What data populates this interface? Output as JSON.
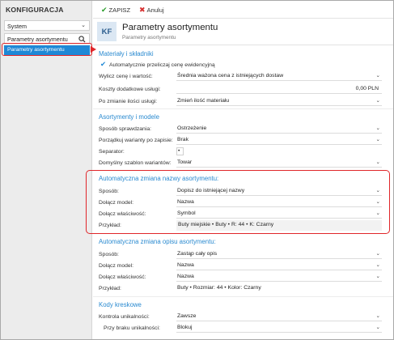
{
  "sidebar": {
    "title": "KONFIGURACJA",
    "select_value": "System",
    "search_value": "Parametry asortymentu",
    "active_item": "Parametry asortymentu"
  },
  "toolbar": {
    "save_label": "ZAPISZ",
    "cancel_label": "Anuluj"
  },
  "header": {
    "badge": "KF",
    "title": "Parametry asortymentu",
    "subtitle": "Parametry asortymentu"
  },
  "sections": {
    "materials": {
      "title": "Materiały i składniki",
      "checkbox_label": "Automatycznie przeliczaj cenę ewidencyjną",
      "rows": [
        {
          "label": "Wylicz cenę i wartość:",
          "value": "Średnia ważona cena z istniejących dostaw"
        },
        {
          "label": "Koszty dodatkowe usługi:",
          "value": "0,00 PLN"
        },
        {
          "label": "Po zmianie ilości usługi:",
          "value": "Zmień ilość materiału"
        }
      ]
    },
    "assortment": {
      "title": "Asortymenty i modele",
      "rows": [
        {
          "label": "Sposób sprawdzania:",
          "value": "Ostrzeżenie"
        },
        {
          "label": "Porządkuj warianty po zapisie:",
          "value": "Brak"
        },
        {
          "label": "Separator:",
          "value": "•"
        },
        {
          "label": "Domyślny szablon wariantów:",
          "value": "Towar"
        }
      ]
    },
    "auto_name": {
      "title": "Automatyczna zmiana nazwy asortymentu:",
      "rows": [
        {
          "label": "Sposób:",
          "value": "Dopisz do istniejącej nazwy"
        },
        {
          "label": "Dołącz model:",
          "value": "Nazwa"
        },
        {
          "label": "Dołącz właściwość:",
          "value": "Symbol"
        },
        {
          "label": "Przykład:",
          "value": "Buty miejskie • Buty • R: 44 • K: Czarny"
        }
      ]
    },
    "auto_desc": {
      "title": "Automatyczna zmiana opisu asortymentu:",
      "rows": [
        {
          "label": "Sposób:",
          "value": "Zastąp cały opis"
        },
        {
          "label": "Dołącz model:",
          "value": "Nazwa"
        },
        {
          "label": "Dołącz właściwość:",
          "value": "Nazwa"
        },
        {
          "label": "Przykład:",
          "value": "Buty • Rozmiar: 44 • Kolor: Czarny"
        }
      ]
    },
    "barcodes": {
      "title": "Kody kreskowe",
      "rows": [
        {
          "label": "Kontrola unikalności:",
          "value": "Zawsze"
        },
        {
          "label": "Przy braku unikalności:",
          "value": "Blokuj"
        }
      ]
    }
  },
  "colors": {
    "accent": "#1e88d6",
    "highlight": "#e0262a",
    "section_title": "#2a8ad0"
  }
}
